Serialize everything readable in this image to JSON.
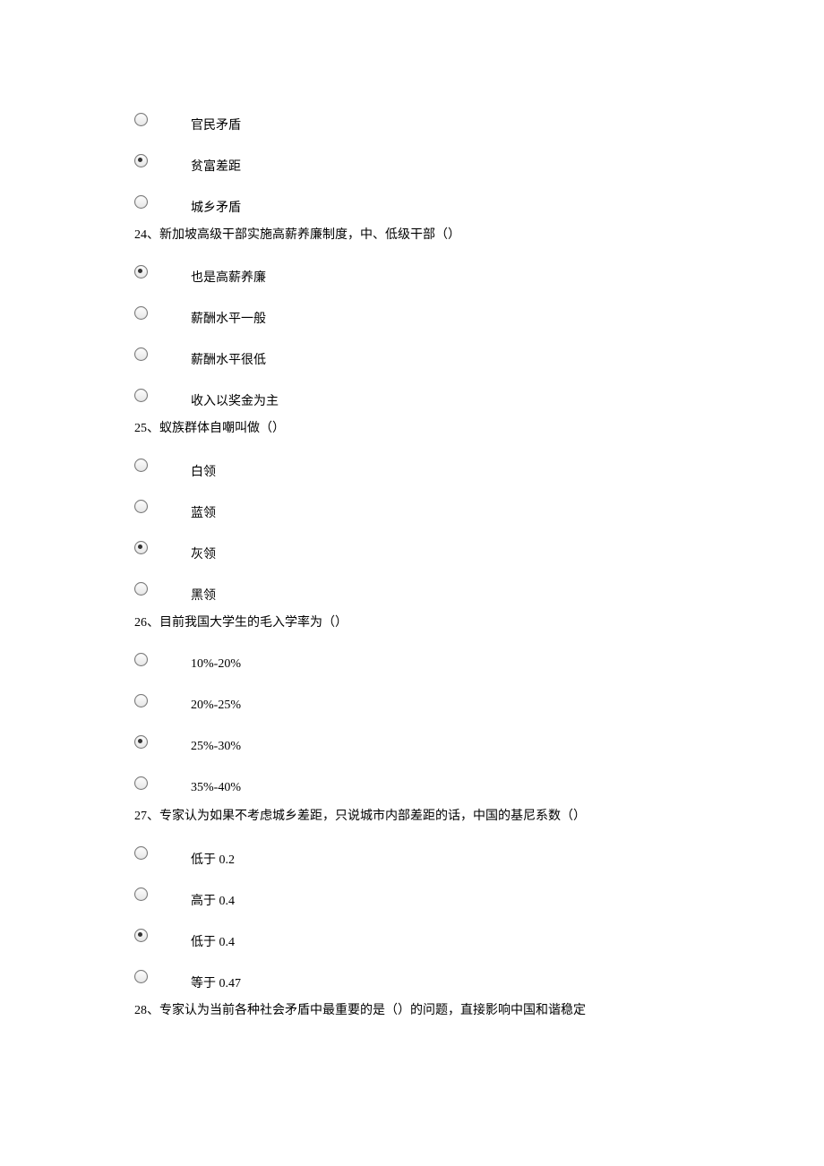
{
  "q23_extra": {
    "options": [
      {
        "label": "官民矛盾",
        "selected": false
      },
      {
        "label": "贫富差距",
        "selected": true
      },
      {
        "label": "城乡矛盾",
        "selected": false
      }
    ]
  },
  "q24": {
    "text": "24、新加坡高级干部实施高薪养廉制度，中、低级干部（）",
    "options": [
      {
        "label": "也是高薪养廉",
        "selected": true
      },
      {
        "label": "薪酬水平一般",
        "selected": false
      },
      {
        "label": "薪酬水平很低",
        "selected": false
      },
      {
        "label": "收入以奖金为主",
        "selected": false
      }
    ]
  },
  "q25": {
    "text": "25、蚁族群体自嘲叫做（）",
    "options": [
      {
        "label": "白领",
        "selected": false
      },
      {
        "label": "蓝领",
        "selected": false
      },
      {
        "label": "灰领",
        "selected": true
      },
      {
        "label": "黑领",
        "selected": false
      }
    ]
  },
  "q26": {
    "text": "26、目前我国大学生的毛入学率为（）",
    "options": [
      {
        "label": "10%-20%",
        "selected": false
      },
      {
        "label": "20%-25%",
        "selected": false
      },
      {
        "label": "25%-30%",
        "selected": true
      },
      {
        "label": "35%-40%",
        "selected": false
      }
    ]
  },
  "q27": {
    "text": "27、专家认为如果不考虑城乡差距，只说城市内部差距的话，中国的基尼系数（）",
    "options": [
      {
        "label": "低于 0.2",
        "selected": false
      },
      {
        "label": "高于 0.4",
        "selected": false
      },
      {
        "label": "低于 0.4",
        "selected": true
      },
      {
        "label": "等于 0.47",
        "selected": false
      }
    ]
  },
  "q28": {
    "text": "28、专家认为当前各种社会矛盾中最重要的是（）的问题，直接影响中国和谐稳定"
  }
}
